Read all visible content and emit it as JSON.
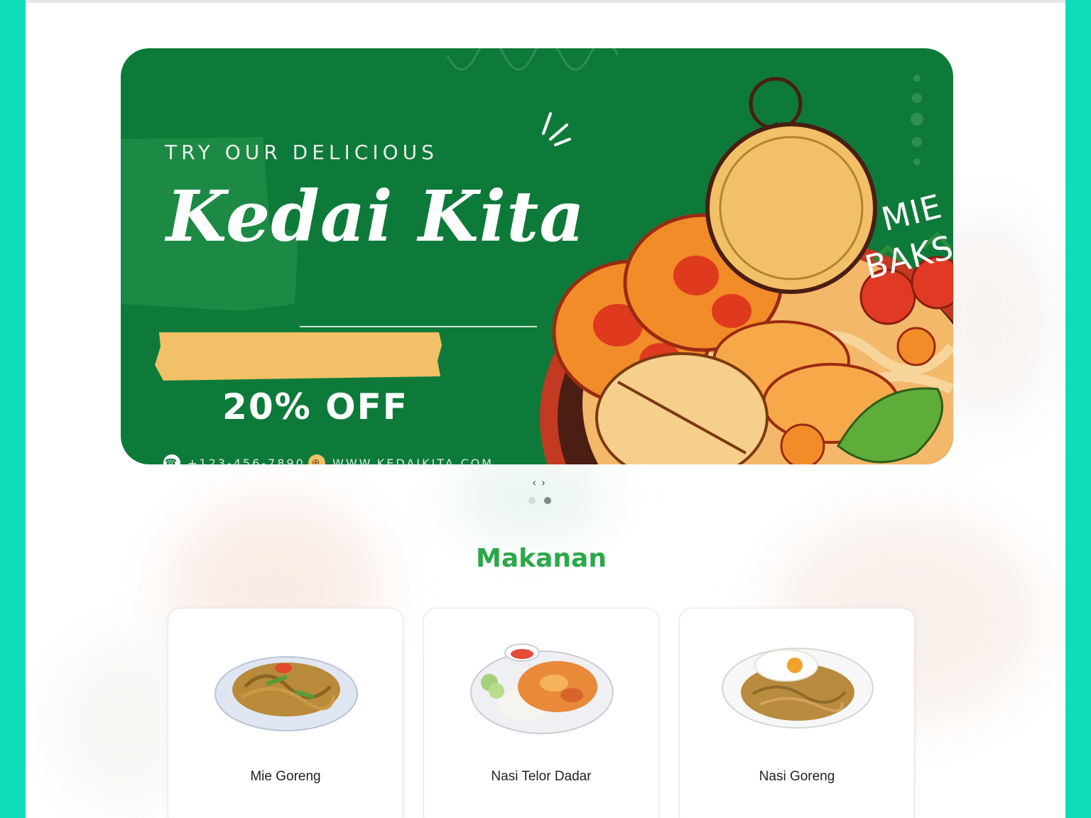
{
  "banner": {
    "tagline": "TRY OUR DELICIOUS",
    "brand": "Kedai Kita",
    "discount": "20% OFF",
    "phone": "+123-456-7890",
    "website": "WWW.KEDAIKITA.COM",
    "tag_line1": "MIE",
    "tag_line2": "BAKSO"
  },
  "carousel": {
    "prev": "‹",
    "next": "›",
    "slides": 2,
    "active_index": 1
  },
  "section": {
    "title": "Makanan"
  },
  "menu": [
    {
      "name": "Mie Goreng"
    },
    {
      "name": "Nasi Telor Dadar"
    },
    {
      "name": "Nasi Goreng"
    }
  ],
  "colors": {
    "frame": "#0fdcb9",
    "banner_green": "#0d7a3a",
    "accent_yellow": "#f2c066",
    "title_green": "#2aa84a"
  }
}
